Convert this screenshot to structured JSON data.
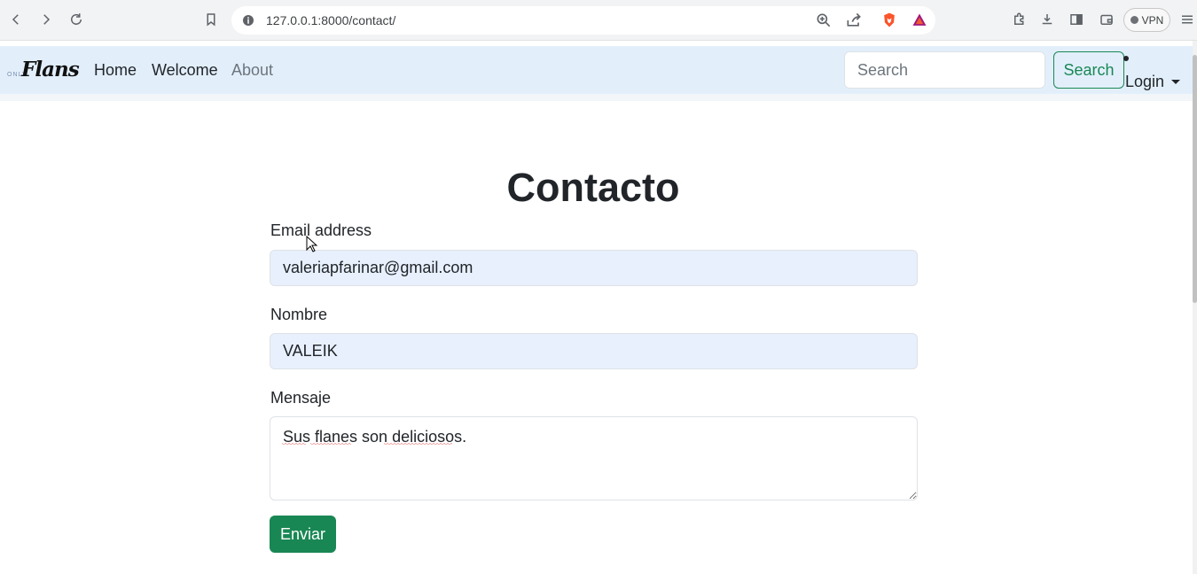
{
  "browser": {
    "url": "127.0.0.1:8000/contact/",
    "vpn_label": "VPN"
  },
  "navbar": {
    "brand_small": "ONLY",
    "brand_big": "Flans",
    "links": [
      {
        "label": "Home"
      },
      {
        "label": "Welcome"
      },
      {
        "label": "About"
      }
    ],
    "search_placeholder": "Search",
    "search_button": "Search",
    "login_label": "Login"
  },
  "form": {
    "title": "Contacto",
    "email_label": "Email address",
    "email_value": "valeriapfarinar@gmail.com",
    "name_label": "Nombre",
    "name_value": "VALEIK",
    "message_label": "Mensaje",
    "message_value": "Sus flanes son deliciosos.",
    "submit_label": "Enviar"
  },
  "colors": {
    "navbar_bg": "#e2effb",
    "accent": "#198754",
    "autofill_bg": "#e8f0fe"
  }
}
